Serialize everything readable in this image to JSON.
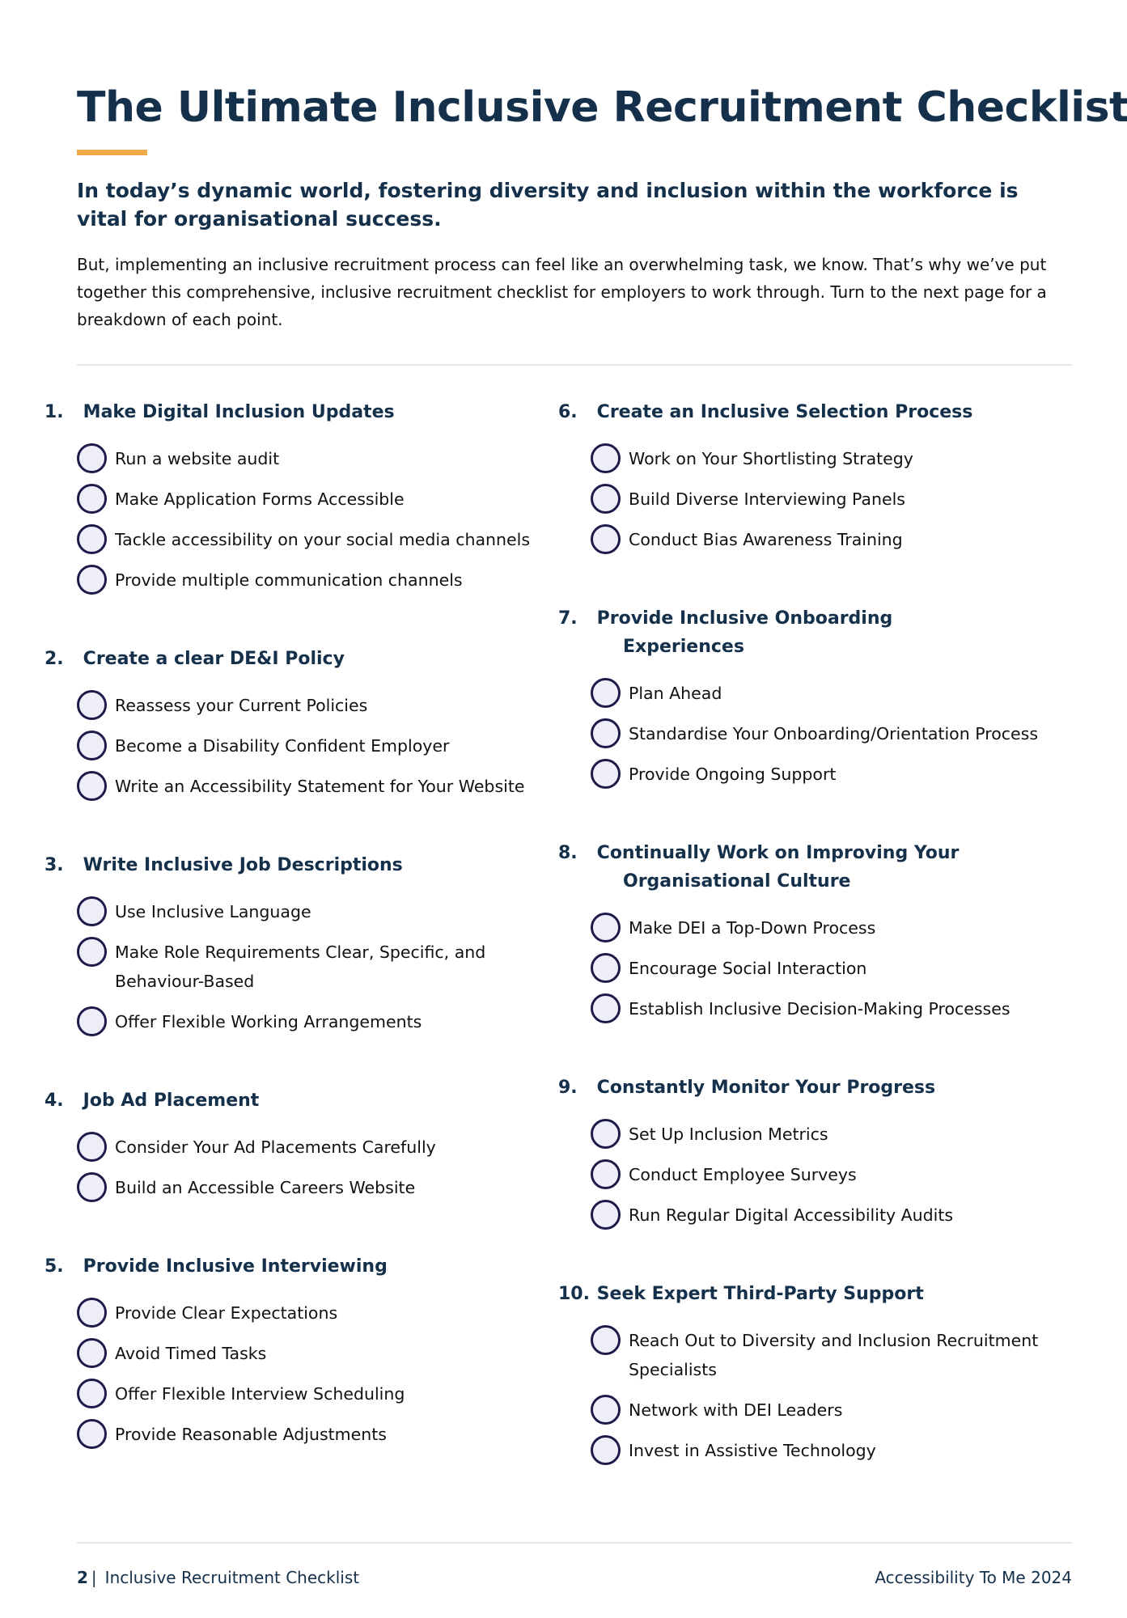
{
  "document": {
    "title": "The Ultimate Inclusive Recruitment Checklist",
    "lead": "In today’s dynamic world, fostering diversity and inclusion within the workforce is vital for organisational success.",
    "intro": "But, implementing an inclusive recruitment process can feel like an overwhelming task, we know. That’s why we’ve put together this comprehensive, inclusive recruitment checklist for employers to work through. Turn to the next page for a breakdown of each point.",
    "accent_color": "#EFA84A",
    "heading_color": "#15304A",
    "checkbox_border_color": "#1E1B4B",
    "checkbox_fill_color": "#EEEEF8"
  },
  "sections": [
    {
      "number": "1.",
      "title": "Make Digital Inclusion Updates",
      "items": [
        {
          "label": "Run a website audit",
          "checked": false
        },
        {
          "label": "Make Application Forms Accessible",
          "checked": false
        },
        {
          "label": "Tackle accessibility on your social media channels",
          "checked": false
        },
        {
          "label": "Provide multiple communication channels",
          "checked": false
        }
      ]
    },
    {
      "number": "2.",
      "title": "Create a clear DE&I Policy",
      "items": [
        {
          "label": "Reassess your Current Policies",
          "checked": false
        },
        {
          "label": "Become a Disability Confident Employer",
          "checked": false
        },
        {
          "label": "Write an Accessibility Statement for Your Website",
          "checked": false
        }
      ]
    },
    {
      "number": "3.",
      "title": "Write Inclusive Job Descriptions",
      "items": [
        {
          "label": "Use Inclusive Language",
          "checked": false
        },
        {
          "label": "Make Role Requirements Clear, Specific, and Behaviour-Based",
          "checked": false
        },
        {
          "label": "Offer Flexible Working Arrangements",
          "checked": false
        }
      ]
    },
    {
      "number": "4.",
      "title": "Job Ad Placement",
      "items": [
        {
          "label": "Consider Your Ad Placements Carefully",
          "checked": false
        },
        {
          "label": "Build an Accessible Careers Website",
          "checked": false
        }
      ]
    },
    {
      "number": "5.",
      "title": "Provide Inclusive Interviewing",
      "items": [
        {
          "label": "Provide Clear Expectations",
          "checked": false
        },
        {
          "label": "Avoid Timed Tasks",
          "checked": false
        },
        {
          "label": "Offer Flexible Interview Scheduling",
          "checked": false
        },
        {
          "label": "Provide Reasonable Adjustments",
          "checked": false
        }
      ]
    },
    {
      "number": "6.",
      "title": "Create an Inclusive Selection Process",
      "items": [
        {
          "label": "Work on Your Shortlisting Strategy",
          "checked": false
        },
        {
          "label": "Build Diverse Interviewing Panels",
          "checked": false
        },
        {
          "label": "Conduct Bias Awareness Training",
          "checked": false
        }
      ]
    },
    {
      "number": "7.",
      "title": "Provide Inclusive Onboarding Experiences",
      "items": [
        {
          "label": "Plan Ahead",
          "checked": false
        },
        {
          "label": "Standardise Your Onboarding/Orientation Process",
          "checked": false
        },
        {
          "label": "Provide Ongoing Support",
          "checked": false
        }
      ]
    },
    {
      "number": "8.",
      "title": "Continually Work on Improving Your Organisational Culture",
      "items": [
        {
          "label": "Make DEI a Top-Down Process",
          "checked": false
        },
        {
          "label": "Encourage Social Interaction",
          "checked": false
        },
        {
          "label": "Establish Inclusive Decision-Making Processes",
          "checked": false
        }
      ]
    },
    {
      "number": "9.",
      "title": "Constantly Monitor Your Progress",
      "items": [
        {
          "label": "Set Up Inclusion Metrics",
          "checked": false
        },
        {
          "label": "Conduct Employee Surveys",
          "checked": false
        },
        {
          "label": "Run Regular Digital Accessibility Audits",
          "checked": false
        }
      ]
    },
    {
      "number": "10.",
      "title": "Seek Expert Third-Party Support",
      "items": [
        {
          "label": "Reach Out to Diversity and Inclusion Recruitment Specialists",
          "checked": false
        },
        {
          "label": "Network with DEI Leaders",
          "checked": false
        },
        {
          "label": "Invest in Assistive Technology",
          "checked": false
        }
      ]
    }
  ],
  "footer": {
    "page_number": "2",
    "separator": "|",
    "document_name": "Inclusive Recruitment Checklist",
    "publisher": "Accessibility To Me 2024"
  }
}
